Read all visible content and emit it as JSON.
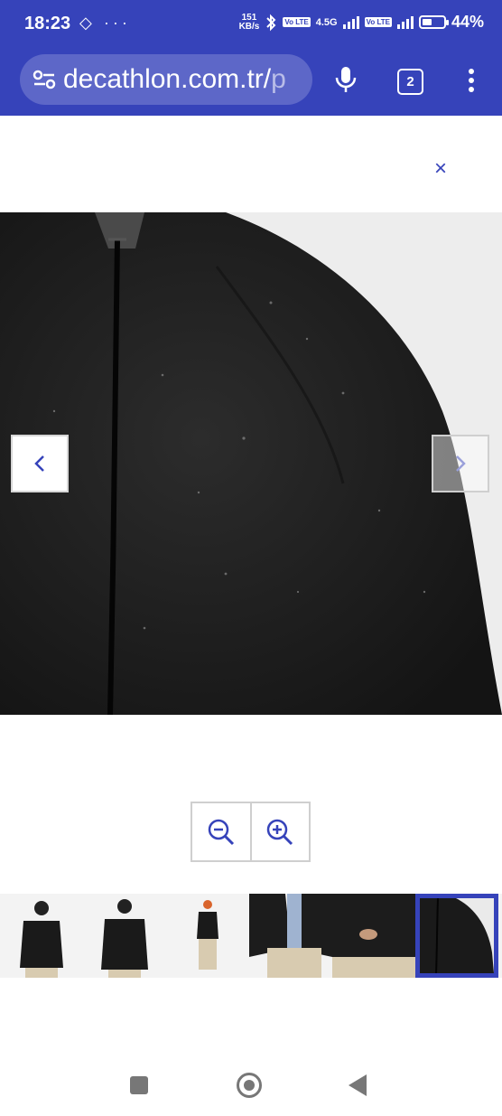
{
  "status_bar": {
    "time": "18:23",
    "left_icons": "◇ ···",
    "speed_value": "151",
    "speed_unit": "KB/s",
    "volte_badge_1": "Vo LTE",
    "network_type": "4.5G",
    "volte_badge_2": "Vo LTE",
    "battery_percent": "44%",
    "battery_level": 0.44
  },
  "browser": {
    "url_visible": "decathlon.com.tr/",
    "url_dim": "p",
    "tab_count": "2",
    "mic_icon": "mic-icon",
    "menu_icon": "kebab-menu-icon",
    "site_settings_icon": "tune-icon"
  },
  "viewer": {
    "close_label": "×",
    "prev_icon": "chevron-left-icon",
    "next_icon": "chevron-right-icon",
    "zoom_out_icon": "zoom-out-icon",
    "zoom_in_icon": "zoom-in-icon",
    "thumbnails": [
      {
        "kind": "model-front-hood"
      },
      {
        "kind": "model-front-hood-2"
      },
      {
        "kind": "model-full-body"
      },
      {
        "kind": "detail-open-jacket"
      },
      {
        "kind": "detail-pocket"
      },
      {
        "kind": "detail-fabric",
        "active": true
      }
    ]
  },
  "colors": {
    "brand_blue": "#3643ba",
    "omnibox": "#5d67c8"
  }
}
